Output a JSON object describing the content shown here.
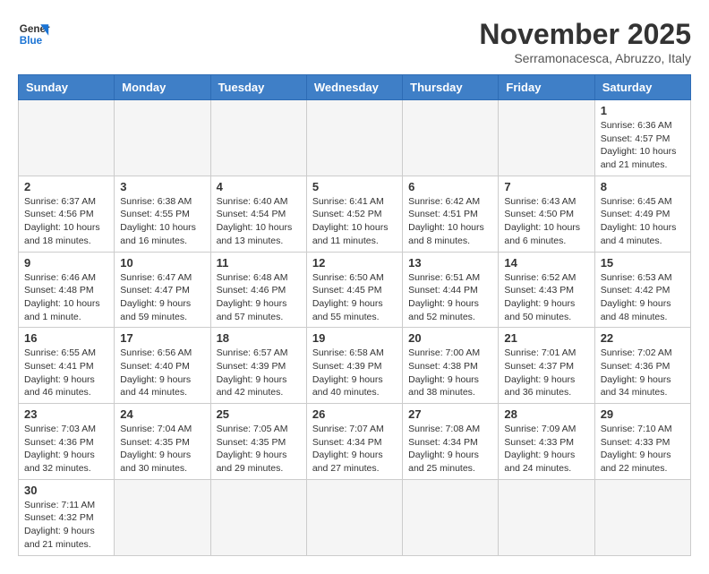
{
  "logo": {
    "line1": "General",
    "line2": "Blue"
  },
  "title": "November 2025",
  "subtitle": "Serramonacesca, Abruzzo, Italy",
  "weekdays": [
    "Sunday",
    "Monday",
    "Tuesday",
    "Wednesday",
    "Thursday",
    "Friday",
    "Saturday"
  ],
  "weeks": [
    [
      {
        "day": "",
        "info": ""
      },
      {
        "day": "",
        "info": ""
      },
      {
        "day": "",
        "info": ""
      },
      {
        "day": "",
        "info": ""
      },
      {
        "day": "",
        "info": ""
      },
      {
        "day": "",
        "info": ""
      },
      {
        "day": "1",
        "info": "Sunrise: 6:36 AM\nSunset: 4:57 PM\nDaylight: 10 hours and 21 minutes."
      }
    ],
    [
      {
        "day": "2",
        "info": "Sunrise: 6:37 AM\nSunset: 4:56 PM\nDaylight: 10 hours and 18 minutes."
      },
      {
        "day": "3",
        "info": "Sunrise: 6:38 AM\nSunset: 4:55 PM\nDaylight: 10 hours and 16 minutes."
      },
      {
        "day": "4",
        "info": "Sunrise: 6:40 AM\nSunset: 4:54 PM\nDaylight: 10 hours and 13 minutes."
      },
      {
        "day": "5",
        "info": "Sunrise: 6:41 AM\nSunset: 4:52 PM\nDaylight: 10 hours and 11 minutes."
      },
      {
        "day": "6",
        "info": "Sunrise: 6:42 AM\nSunset: 4:51 PM\nDaylight: 10 hours and 8 minutes."
      },
      {
        "day": "7",
        "info": "Sunrise: 6:43 AM\nSunset: 4:50 PM\nDaylight: 10 hours and 6 minutes."
      },
      {
        "day": "8",
        "info": "Sunrise: 6:45 AM\nSunset: 4:49 PM\nDaylight: 10 hours and 4 minutes."
      }
    ],
    [
      {
        "day": "9",
        "info": "Sunrise: 6:46 AM\nSunset: 4:48 PM\nDaylight: 10 hours and 1 minute."
      },
      {
        "day": "10",
        "info": "Sunrise: 6:47 AM\nSunset: 4:47 PM\nDaylight: 9 hours and 59 minutes."
      },
      {
        "day": "11",
        "info": "Sunrise: 6:48 AM\nSunset: 4:46 PM\nDaylight: 9 hours and 57 minutes."
      },
      {
        "day": "12",
        "info": "Sunrise: 6:50 AM\nSunset: 4:45 PM\nDaylight: 9 hours and 55 minutes."
      },
      {
        "day": "13",
        "info": "Sunrise: 6:51 AM\nSunset: 4:44 PM\nDaylight: 9 hours and 52 minutes."
      },
      {
        "day": "14",
        "info": "Sunrise: 6:52 AM\nSunset: 4:43 PM\nDaylight: 9 hours and 50 minutes."
      },
      {
        "day": "15",
        "info": "Sunrise: 6:53 AM\nSunset: 4:42 PM\nDaylight: 9 hours and 48 minutes."
      }
    ],
    [
      {
        "day": "16",
        "info": "Sunrise: 6:55 AM\nSunset: 4:41 PM\nDaylight: 9 hours and 46 minutes."
      },
      {
        "day": "17",
        "info": "Sunrise: 6:56 AM\nSunset: 4:40 PM\nDaylight: 9 hours and 44 minutes."
      },
      {
        "day": "18",
        "info": "Sunrise: 6:57 AM\nSunset: 4:39 PM\nDaylight: 9 hours and 42 minutes."
      },
      {
        "day": "19",
        "info": "Sunrise: 6:58 AM\nSunset: 4:39 PM\nDaylight: 9 hours and 40 minutes."
      },
      {
        "day": "20",
        "info": "Sunrise: 7:00 AM\nSunset: 4:38 PM\nDaylight: 9 hours and 38 minutes."
      },
      {
        "day": "21",
        "info": "Sunrise: 7:01 AM\nSunset: 4:37 PM\nDaylight: 9 hours and 36 minutes."
      },
      {
        "day": "22",
        "info": "Sunrise: 7:02 AM\nSunset: 4:36 PM\nDaylight: 9 hours and 34 minutes."
      }
    ],
    [
      {
        "day": "23",
        "info": "Sunrise: 7:03 AM\nSunset: 4:36 PM\nDaylight: 9 hours and 32 minutes."
      },
      {
        "day": "24",
        "info": "Sunrise: 7:04 AM\nSunset: 4:35 PM\nDaylight: 9 hours and 30 minutes."
      },
      {
        "day": "25",
        "info": "Sunrise: 7:05 AM\nSunset: 4:35 PM\nDaylight: 9 hours and 29 minutes."
      },
      {
        "day": "26",
        "info": "Sunrise: 7:07 AM\nSunset: 4:34 PM\nDaylight: 9 hours and 27 minutes."
      },
      {
        "day": "27",
        "info": "Sunrise: 7:08 AM\nSunset: 4:34 PM\nDaylight: 9 hours and 25 minutes."
      },
      {
        "day": "28",
        "info": "Sunrise: 7:09 AM\nSunset: 4:33 PM\nDaylight: 9 hours and 24 minutes."
      },
      {
        "day": "29",
        "info": "Sunrise: 7:10 AM\nSunset: 4:33 PM\nDaylight: 9 hours and 22 minutes."
      }
    ],
    [
      {
        "day": "30",
        "info": "Sunrise: 7:11 AM\nSunset: 4:32 PM\nDaylight: 9 hours and 21 minutes."
      },
      {
        "day": "",
        "info": ""
      },
      {
        "day": "",
        "info": ""
      },
      {
        "day": "",
        "info": ""
      },
      {
        "day": "",
        "info": ""
      },
      {
        "day": "",
        "info": ""
      },
      {
        "day": "",
        "info": ""
      }
    ]
  ]
}
